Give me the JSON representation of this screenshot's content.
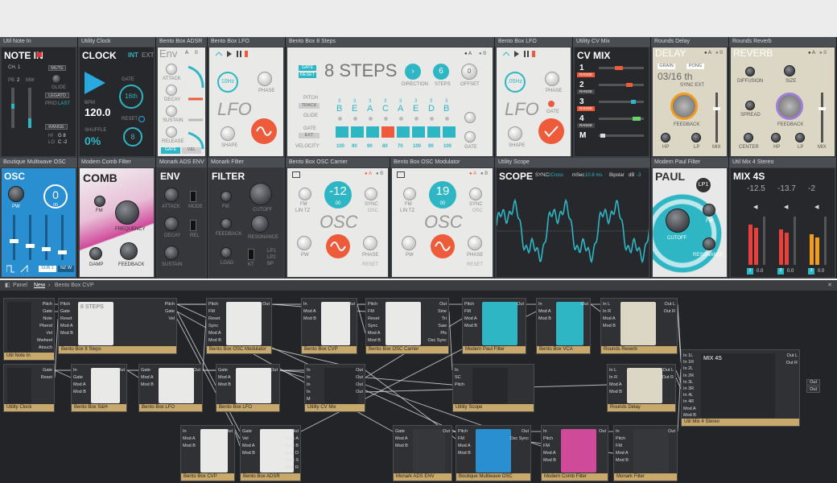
{
  "rack_modules": [
    {
      "id": "util-note-in",
      "title": "Util Note In",
      "face_title": "NOTE IN",
      "labels": [
        "CH. 1",
        "MUTE",
        "PB",
        "2",
        "MW",
        "GLIDE",
        "LEGATO",
        "PRIO",
        "LAST",
        "RANGE",
        "HI",
        "G 8",
        "LO",
        "C -2"
      ]
    },
    {
      "id": "utility-clock",
      "title": "Utility Clock",
      "face_title": "CLOCK",
      "int": "INT",
      "ext": "EXT",
      "gate": "GATE",
      "gate_val": "16th",
      "bpm_label": "BPM",
      "bpm": "120.0",
      "shuffle_label": "SHUFFLE",
      "shuffle": "0%",
      "reset": "RESET",
      "reset_val": "8"
    },
    {
      "id": "bento-adsr",
      "title": "Bento Box ADSR",
      "face_title": "Env",
      "a": "A",
      "b": "B",
      "labels": [
        "ATTACK",
        "DECAY",
        "SUSTAIN",
        "RELEASE",
        "GATE",
        "VEL"
      ]
    },
    {
      "id": "bento-lfo-1",
      "title": "Bento Box LFO",
      "face_title": "LFO",
      "rate": "10Hz",
      "labels": [
        "PHASE",
        "SHAPE"
      ]
    },
    {
      "id": "bento-8steps",
      "title": "Bento Box 8 Steps",
      "face_title": "8 STEPS",
      "gate": "GATE",
      "reset": "RESET",
      "direction": "DIRECTION",
      "steps": "STEPS",
      "steps_val": "6",
      "offset": "OFFSET",
      "offset_val": "0",
      "pitch": "PITCH",
      "track": "TRACK",
      "glide": "GLIDE",
      "gate_row": "GATE",
      "gate_ext": "EXT",
      "velocity": "VELOCITY",
      "notes": [
        "B",
        "E",
        "A",
        "C",
        "A",
        "E",
        "D",
        "B"
      ],
      "octaves": [
        "3",
        "3",
        "3",
        "3",
        "3",
        "3",
        "3",
        "3"
      ],
      "velocities": [
        "100",
        "90",
        "90",
        "80",
        "70",
        "100",
        "90",
        "100"
      ]
    },
    {
      "id": "bento-lfo-2",
      "title": "Bento Box LFO",
      "face_title": "LFO",
      "rate": ".05Hz",
      "labels": [
        "PHASE",
        "GATE",
        "SHAPE"
      ]
    },
    {
      "id": "utility-cv-mix",
      "title": "Utility CV Mix",
      "face_title": "CV MIX",
      "rows": [
        "1",
        "2",
        "3",
        "4",
        "M"
      ],
      "range": "RANGE"
    },
    {
      "id": "rounds-delay",
      "title": "Rounds Delay",
      "face_title": "DELAY",
      "grain": "GRAIN",
      "pong": "PONG",
      "time": "03/16 th",
      "sync": "SYNC EXT",
      "labels": [
        "FEEDBACK",
        "HP",
        "LP",
        "MIX"
      ]
    },
    {
      "id": "rounds-reverb",
      "title": "Rounds Reverb",
      "face_title": "REVERB",
      "labels": [
        "DIFFUSION",
        "SIZE",
        "SPREAD",
        "FEEDBACK",
        "CENTER",
        "HP",
        "LP",
        "MIX"
      ]
    },
    {
      "id": "boutique-osc",
      "title": "Boutique Multiwave OSC",
      "face_title": "OSC",
      "value": "0",
      "sub": "00",
      "labels": [
        "PW",
        "SUB 1",
        "NZ W"
      ]
    },
    {
      "id": "modern-comb",
      "title": "Modern Comb Filter",
      "face_title": "COMB",
      "labels": [
        "FM",
        "FREQUENCY",
        "DAMP",
        "FEEDBACK"
      ]
    },
    {
      "id": "monark-adsenv",
      "title": "Monark ADS ENV",
      "face_title": "ENV",
      "labels": [
        "ATTACK",
        "MODE",
        "DECAY",
        "REL",
        "SUSTAIN"
      ]
    },
    {
      "id": "monark-filter",
      "title": "Monark Filter",
      "face_title": "FILTER",
      "labels": [
        "FM",
        "CUTOFF",
        "FEEDBACK",
        "RESONANCE",
        "LOAD",
        "KT",
        "LP1",
        "LP2",
        "BP"
      ]
    },
    {
      "id": "bento-osc-carrier",
      "title": "Bento Box OSC Carrier",
      "face_title": "OSC",
      "value": "-12",
      "sub": "00",
      "labels": [
        "FM",
        "LIN TZ",
        "SYNC",
        "PW",
        "PHASE",
        "RESET"
      ]
    },
    {
      "id": "bento-osc-mod",
      "title": "Bento Box OSC Modulator",
      "face_title": "OSC",
      "value": "19",
      "sub": "00",
      "labels": [
        "FM",
        "LIN TZ",
        "SYNC",
        "PW",
        "PHASE",
        "RESET"
      ]
    },
    {
      "id": "utility-scope",
      "title": "Utility Scope",
      "face_title": "SCOPE",
      "sync": "SYNC",
      "sync_val": "2Cross",
      "msec": "mSec",
      "msec_val": "10.8 ms",
      "bipolar": "Bipolar",
      "db": "dB",
      "db_val": "-3"
    },
    {
      "id": "modern-paul",
      "title": "Modern Paul Filter",
      "face_title": "PAUL",
      "mode": "LP1",
      "labels": [
        "CUTOFF",
        "FM",
        "RESONANCE"
      ]
    },
    {
      "id": "util-mix4",
      "title": "Util Mix 4 Stereo",
      "face_title": "MIX 4S",
      "levels": [
        "-12.5",
        "-13.7",
        "-2"
      ],
      "zero": "0.0",
      "ch": [
        "1",
        "2",
        "3"
      ]
    }
  ],
  "panel_bar": {
    "panel": "Panel",
    "new": "New",
    "crumb": "Bento Box CVP"
  },
  "nodes": [
    {
      "id": "n-note",
      "title": "Util Note In",
      "out": [
        "Pitch",
        "Gate",
        "Note",
        "Pbend",
        "Vel",
        "Mwheel",
        "Atouch"
      ]
    },
    {
      "id": "n-8steps",
      "title": "Bento Box 8 Steps",
      "thumb": "8 STEPS",
      "in": [
        "Pitch",
        "Gate",
        "Reset",
        "Mod A",
        "Mod B"
      ],
      "out": [
        "Pitch",
        "Gate",
        "Vel"
      ]
    },
    {
      "id": "n-oscmod",
      "title": "Bento Box OSC Modulator",
      "in": [
        "Pitch",
        "FM",
        "Reset",
        "Sync",
        "Mod A",
        "Mod B"
      ],
      "out": [
        "Out"
      ]
    },
    {
      "id": "n-cvp1",
      "title": "Bento Box CVP",
      "in": [
        "In",
        "Mod A",
        "Mod B"
      ],
      "out": [
        "Out"
      ]
    },
    {
      "id": "n-osccar",
      "title": "Bento Box OSC Carrier",
      "in": [
        "Pitch",
        "FM",
        "Reset",
        "Sync",
        "Mod A",
        "Mod B"
      ],
      "out": [
        "Out",
        "Sine",
        "Tri",
        "Saw",
        "Pls",
        "Osc Sync"
      ]
    },
    {
      "id": "n-paul",
      "title": "Modern Paul Filter",
      "in": [
        "Pitch",
        "FM",
        "Mod A",
        "Mod B"
      ],
      "out": [
        "Out"
      ]
    },
    {
      "id": "n-vca",
      "title": "Bento Box VCA",
      "in": [
        "In",
        "Mod A",
        "Mod B"
      ],
      "out": [
        "Out"
      ]
    },
    {
      "id": "n-reverb",
      "title": "Rounds Reverb",
      "in": [
        "In L",
        "In R",
        "Mod A",
        "Mod B"
      ],
      "out": [
        "Out L",
        "Out R"
      ]
    },
    {
      "id": "n-clock",
      "title": "Utility Clock",
      "out": [
        "Gate",
        "Reset"
      ]
    },
    {
      "id": "n-sh",
      "title": "Bento Box S&H",
      "in": [
        "In",
        "Gate",
        "Mod A",
        "Mod B"
      ],
      "out": [
        "Out"
      ]
    },
    {
      "id": "n-lfo1",
      "title": "Bento Box LFO",
      "in": [
        "Gate",
        "Mod A",
        "Mod B"
      ],
      "out": [
        "Out"
      ]
    },
    {
      "id": "n-lfo2",
      "title": "Bento Box LFO",
      "in": [
        "Gate",
        "Mod A",
        "Mod B"
      ],
      "out": [
        "Out"
      ]
    },
    {
      "id": "n-cvmix",
      "title": "Utility CV Mix",
      "in": [
        "In",
        "In",
        "In",
        "In",
        "M"
      ],
      "out": [
        "Out",
        "Out",
        "Out",
        "Out"
      ]
    },
    {
      "id": "n-scope",
      "title": "Utility Scope",
      "in": [
        "In",
        "SC",
        "Pitch"
      ]
    },
    {
      "id": "n-delay",
      "title": "Rounds Delay",
      "in": [
        "In L",
        "In R",
        "Mod A",
        "Mod B"
      ],
      "out": [
        "Out L",
        "Out R"
      ]
    },
    {
      "id": "n-mix4",
      "title": "Util Mix 4 Stereo",
      "thumb": "MIX 4S",
      "in": [
        "In 1L",
        "In 1R",
        "In 2L",
        "In 2R",
        "In 3L",
        "In 3R",
        "In 4L",
        "In 4R",
        "Mod A",
        "Mod B"
      ],
      "out": [
        "Out L",
        "Out R"
      ],
      "out2": [
        "Out",
        "Out"
      ]
    },
    {
      "id": "n-cvp2",
      "title": "Bento Box CVP",
      "in": [
        "In",
        "Mod A",
        "Mod B"
      ],
      "out": [
        "Out"
      ]
    },
    {
      "id": "n-adsr",
      "title": "Bento Box ADSR",
      "in": [
        "Gate",
        "Vel",
        "Mod A",
        "Mod B"
      ],
      "out": [
        "Out",
        "Gate A",
        "Gate B",
        "Gate D",
        "Gate S",
        "Gate R"
      ]
    },
    {
      "id": "n-adsenv",
      "title": "Monark ADS ENV",
      "in": [
        "Gate",
        "Mod A",
        "Mod B"
      ],
      "out": [
        "Out"
      ]
    },
    {
      "id": "n-boutique",
      "title": "Boutique Multiwave OSC",
      "in": [
        "Pitch",
        "FM",
        "Mod A",
        "Mod B"
      ],
      "out": [
        "Out",
        "Osc Sync"
      ]
    },
    {
      "id": "n-comb",
      "title": "Modern Comb Filter",
      "in": [
        "In",
        "Pitch",
        "FM",
        "Mod A",
        "Mod B"
      ],
      "out": [
        "Out"
      ]
    },
    {
      "id": "n-monfilter",
      "title": "Monark Filter",
      "in": [
        "In",
        "Pitch",
        "FM",
        "Mod A",
        "Mod B"
      ],
      "out": [
        "Out"
      ]
    }
  ]
}
